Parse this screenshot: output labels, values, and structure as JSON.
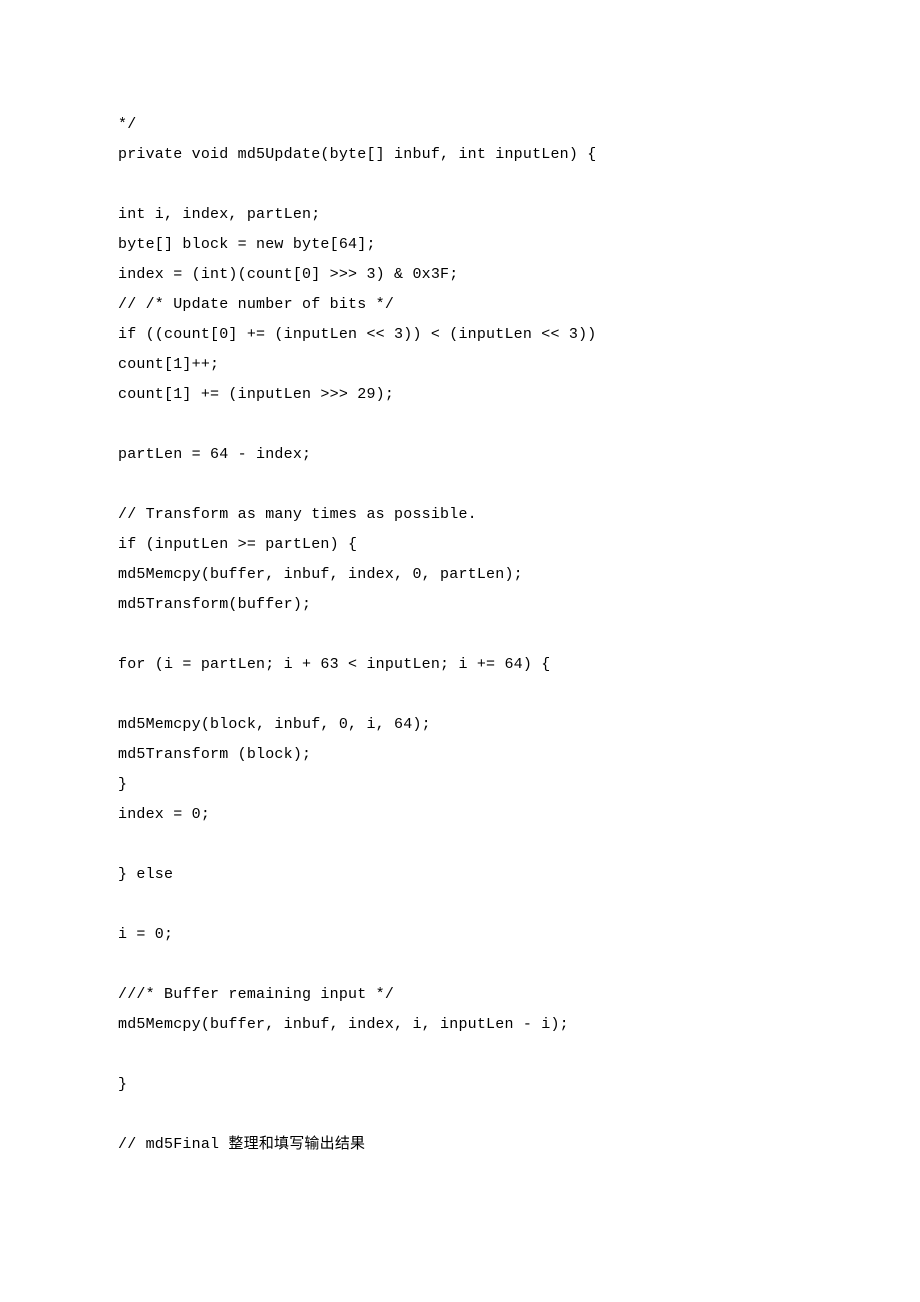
{
  "code": {
    "lines": [
      "*/",
      "private void md5Update(byte[] inbuf, int inputLen) {",
      "",
      "int i, index, partLen;",
      "byte[] block = new byte[64];",
      "index = (int)(count[0] >>> 3) & 0x3F;",
      "// /* Update number of bits */",
      "if ((count[0] += (inputLen << 3)) < (inputLen << 3))",
      "count[1]++;",
      "count[1] += (inputLen >>> 29);",
      "",
      "partLen = 64 - index;",
      "",
      "// Transform as many times as possible.",
      "if (inputLen >= partLen) {",
      "md5Memcpy(buffer, inbuf, index, 0, partLen);",
      "md5Transform(buffer);",
      "",
      "for (i = partLen; i + 63 < inputLen; i += 64) {",
      "",
      "md5Memcpy(block, inbuf, 0, i, 64);",
      "md5Transform (block);",
      "}",
      "index = 0;",
      "",
      "} else",
      "",
      "i = 0;",
      "",
      "///* Buffer remaining input */",
      "md5Memcpy(buffer, inbuf, index, i, inputLen - i);",
      "",
      "}",
      "",
      "// md5Final 整理和填写输出结果"
    ]
  }
}
